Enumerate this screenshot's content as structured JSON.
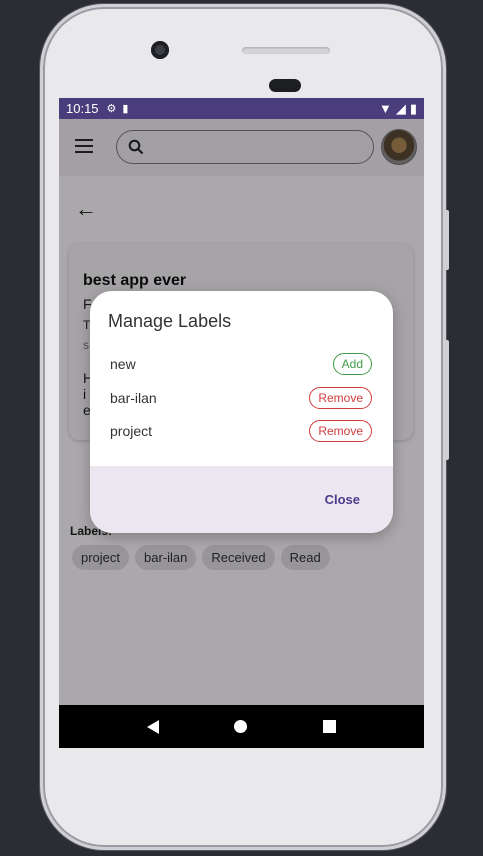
{
  "status_bar": {
    "time": "10:15"
  },
  "search": {
    "placeholder": "",
    "value": ""
  },
  "email": {
    "subject": "best app ever",
    "line1": "F",
    "line2": "T",
    "line3": "s",
    "body1": "H",
    "body2": "i",
    "body3": "e"
  },
  "labels_section": {
    "title": "Labels:",
    "chips": [
      "project",
      "bar-ilan",
      "Received",
      "Read"
    ]
  },
  "dialog": {
    "title": "Manage Labels",
    "rows": [
      {
        "name": "new",
        "action": "Add"
      },
      {
        "name": "bar-ilan",
        "action": "Remove"
      },
      {
        "name": "project",
        "action": "Remove"
      }
    ],
    "close_label": "Close"
  },
  "colors": {
    "status_bar": "#4a3d7c",
    "add_green": "#3f9b48",
    "remove_red": "#d33c3c",
    "dialog_footer": "#ece6f0"
  }
}
